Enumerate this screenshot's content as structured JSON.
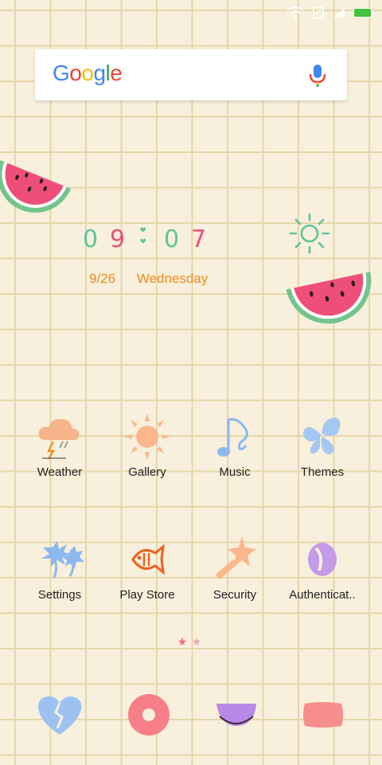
{
  "search": {
    "logo_letters": [
      {
        "ch": "G",
        "color": "#4285f4"
      },
      {
        "ch": "o",
        "color": "#ea4335"
      },
      {
        "ch": "o",
        "color": "#fbbc05"
      },
      {
        "ch": "g",
        "color": "#4285f4"
      },
      {
        "ch": "l",
        "color": "#34a853"
      },
      {
        "ch": "e",
        "color": "#ea4335"
      }
    ]
  },
  "clock": {
    "time_digits": [
      "0",
      "9",
      "0",
      "7"
    ],
    "date": "9/26",
    "weekday": "Wednesday"
  },
  "apps": [
    {
      "label": "Weather",
      "icon": "weather-storm-icon"
    },
    {
      "label": "Gallery",
      "icon": "sun-gallery-icon"
    },
    {
      "label": "Music",
      "icon": "music-note-icon"
    },
    {
      "label": "Themes",
      "icon": "butterfly-icon"
    },
    {
      "label": "Settings",
      "icon": "palm-trees-icon"
    },
    {
      "label": "Play Store",
      "icon": "fish-icon"
    },
    {
      "label": "Security",
      "icon": "star-wand-icon"
    },
    {
      "label": "Authenticat..",
      "icon": "coffee-bean-icon"
    }
  ],
  "dock": [
    {
      "icon": "broken-heart-icon"
    },
    {
      "icon": "donut-icon"
    },
    {
      "icon": "melon-slice-icon"
    },
    {
      "icon": "pink-blob-icon"
    }
  ],
  "colors": {
    "background": "#f8f0dc",
    "grid": "#e6d6ad",
    "clock_date": "#f08a1c",
    "battery": "#43c23e"
  }
}
